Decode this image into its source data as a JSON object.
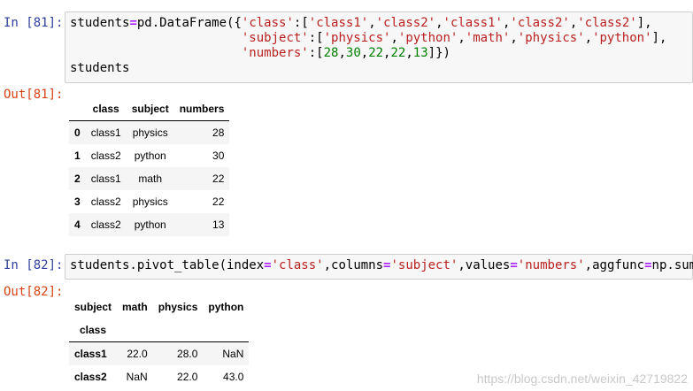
{
  "cell81": {
    "in_prompt": "In [81]:",
    "out_prompt": "Out[81]:",
    "df": {
      "columns": [
        "class",
        "subject",
        "numbers"
      ],
      "rows": [
        {
          "index": "0",
          "class": "class1",
          "subject": "physics",
          "numbers": "28"
        },
        {
          "index": "1",
          "class": "class2",
          "subject": "python",
          "numbers": "30"
        },
        {
          "index": "2",
          "class": "class1",
          "subject": "math",
          "numbers": "22"
        },
        {
          "index": "3",
          "class": "class2",
          "subject": "physics",
          "numbers": "22"
        },
        {
          "index": "4",
          "class": "class2",
          "subject": "python",
          "numbers": "13"
        }
      ]
    }
  },
  "cell82": {
    "in_prompt": "In [82]:",
    "out_prompt": "Out[82]:",
    "df": {
      "columns_name": "subject",
      "columns": [
        "math",
        "physics",
        "python"
      ],
      "index_name": "class",
      "rows": [
        {
          "index": "class1",
          "values": [
            "22.0",
            "28.0",
            "NaN"
          ]
        },
        {
          "index": "class2",
          "values": [
            "NaN",
            "22.0",
            "43.0"
          ]
        }
      ]
    }
  },
  "watermark": "https://blog.csdn.net/weixin_42719822",
  "colors": {
    "prompt_in": "#303f9f",
    "prompt_out": "#d84315",
    "string": "#ba2121",
    "number": "#008000",
    "operator": "#aa22ff",
    "cell_bg": "#f7f7f7"
  }
}
